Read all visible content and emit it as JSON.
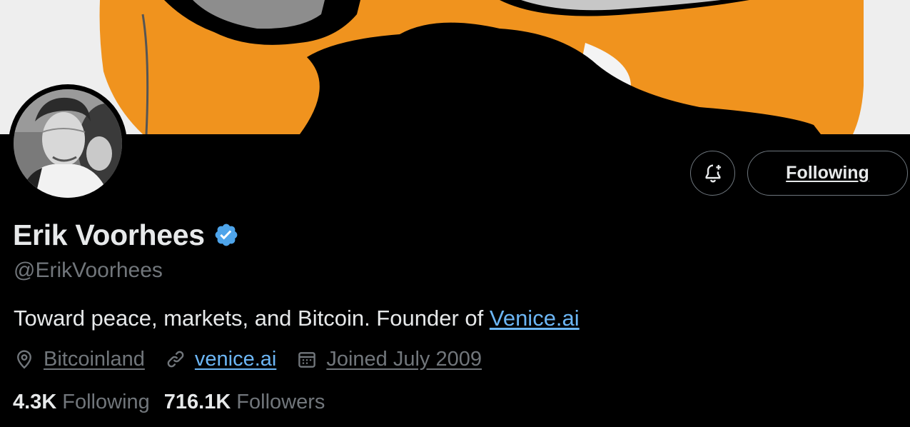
{
  "profile": {
    "display_name": "Erik Voorhees",
    "handle": "@ErikVoorhees",
    "verified": true,
    "bio_text": "Toward peace, markets, and Bitcoin. Founder of ",
    "bio_link": "Venice.ai",
    "location": "Bitcoinland",
    "website": "venice.ai",
    "joined": "Joined July 2009",
    "following_count": "4.3K",
    "following_label": "Following",
    "followers_count": "716.1K",
    "followers_label": "Followers"
  },
  "actions": {
    "follow_button_label": "Following",
    "notify_icon": "bell-plus-icon"
  },
  "icons": {
    "location": "location-pin-icon",
    "website": "link-icon",
    "joined": "calendar-icon",
    "verified": "verified-badge-icon"
  },
  "colors": {
    "background": "#000000",
    "banner_orange": "#f0931e",
    "link_blue": "#6cb6f5",
    "verified_blue": "#4ea4ea",
    "muted_text": "#71767b",
    "primary_text": "#e7e9ea"
  }
}
